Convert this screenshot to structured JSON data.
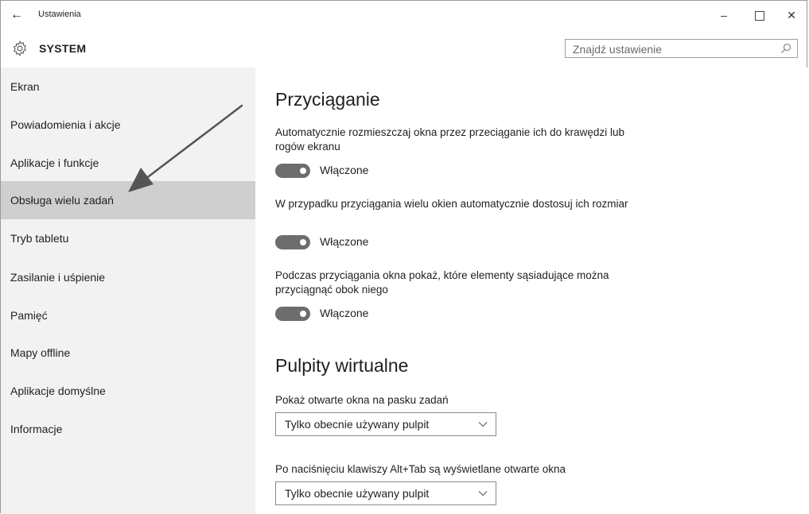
{
  "titlebar": {
    "back_glyph": "←",
    "app_title": "Ustawienia",
    "minimize_glyph": "–",
    "close_glyph": "✕"
  },
  "header": {
    "section_title": "SYSTEM",
    "search_placeholder": "Znajdź ustawienie"
  },
  "sidebar": {
    "items": [
      {
        "label": "Ekran"
      },
      {
        "label": "Powiadomienia i akcje"
      },
      {
        "label": "Aplikacje i funkcje"
      },
      {
        "label": "Obsługa wielu zadań",
        "active": true
      },
      {
        "label": "Tryb tabletu"
      },
      {
        "label": "Zasilanie i uśpienie"
      },
      {
        "label": "Pamięć"
      },
      {
        "label": "Mapy offline"
      },
      {
        "label": "Aplikacje domyślne"
      },
      {
        "label": "Informacje"
      }
    ]
  },
  "content": {
    "snap": {
      "heading": "Przyciąganie",
      "settings": [
        {
          "description": "Automatycznie rozmieszczaj okna przez przeciąganie ich do krawędzi lub rogów ekranu",
          "state": "Włączone"
        },
        {
          "description": "W przypadku przyciągania wielu okien automatycznie dostosuj ich rozmiar",
          "state": "Włączone"
        },
        {
          "description": "Podczas przyciągania okna pokaż, które elementy sąsiadujące można przyciągnąć obok niego",
          "state": "Włączone"
        }
      ]
    },
    "virtual_desktops": {
      "heading": "Pulpity wirtualne",
      "taskbar_label": "Pokaż otwarte okna na pasku zadań",
      "taskbar_value": "Tylko obecnie używany pulpit",
      "alttab_label": "Po naciśnięciu klawiszy Alt+Tab są wyświetlane otwarte okna",
      "alttab_value": "Tylko obecnie używany pulpit"
    }
  },
  "colors": {
    "sidebar_bg": "#f2f2f2",
    "active_item_bg": "#cfcfcf",
    "toggle_on": "#6d6d6d",
    "annotation_arrow": "#555555"
  }
}
